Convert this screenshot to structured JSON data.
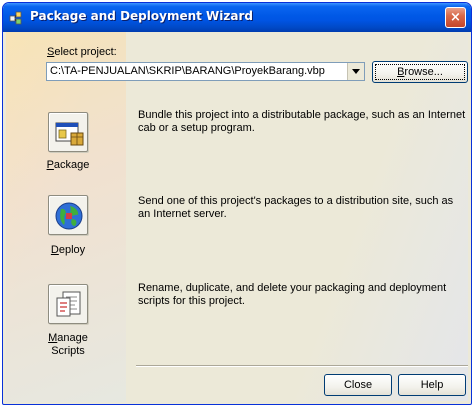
{
  "window": {
    "title": "Package and Deployment Wizard",
    "close_glyph": "×"
  },
  "project": {
    "label_mnemonic": "S",
    "label_rest": "elect project:",
    "path": "C:\\TA-PENJUALAN\\SKRIP\\BARANG\\ProyekBarang.vbp"
  },
  "buttons": {
    "browse_mnemonic": "B",
    "browse_rest": "rowse...",
    "close": "Close",
    "help": "Help"
  },
  "actions": [
    {
      "icon": "package-icon",
      "label_mnemonic": "P",
      "label_rest": "ackage",
      "description": "Bundle this project into a distributable package, such as an Internet cab or a setup program."
    },
    {
      "icon": "deploy-globe-icon",
      "label_mnemonic": "D",
      "label_rest": "eploy",
      "description": "Send one of this project's packages to a distribution site, such as an Internet server."
    },
    {
      "icon": "manage-scripts-icon",
      "label_mnemonic": "M",
      "label_rest": "anage",
      "label_line2": "Scripts",
      "description": "Rename, duplicate, and delete your packaging and deployment scripts for this project."
    }
  ],
  "colors": {
    "titlebar": "#0054e3",
    "face": "#ece9d8"
  }
}
